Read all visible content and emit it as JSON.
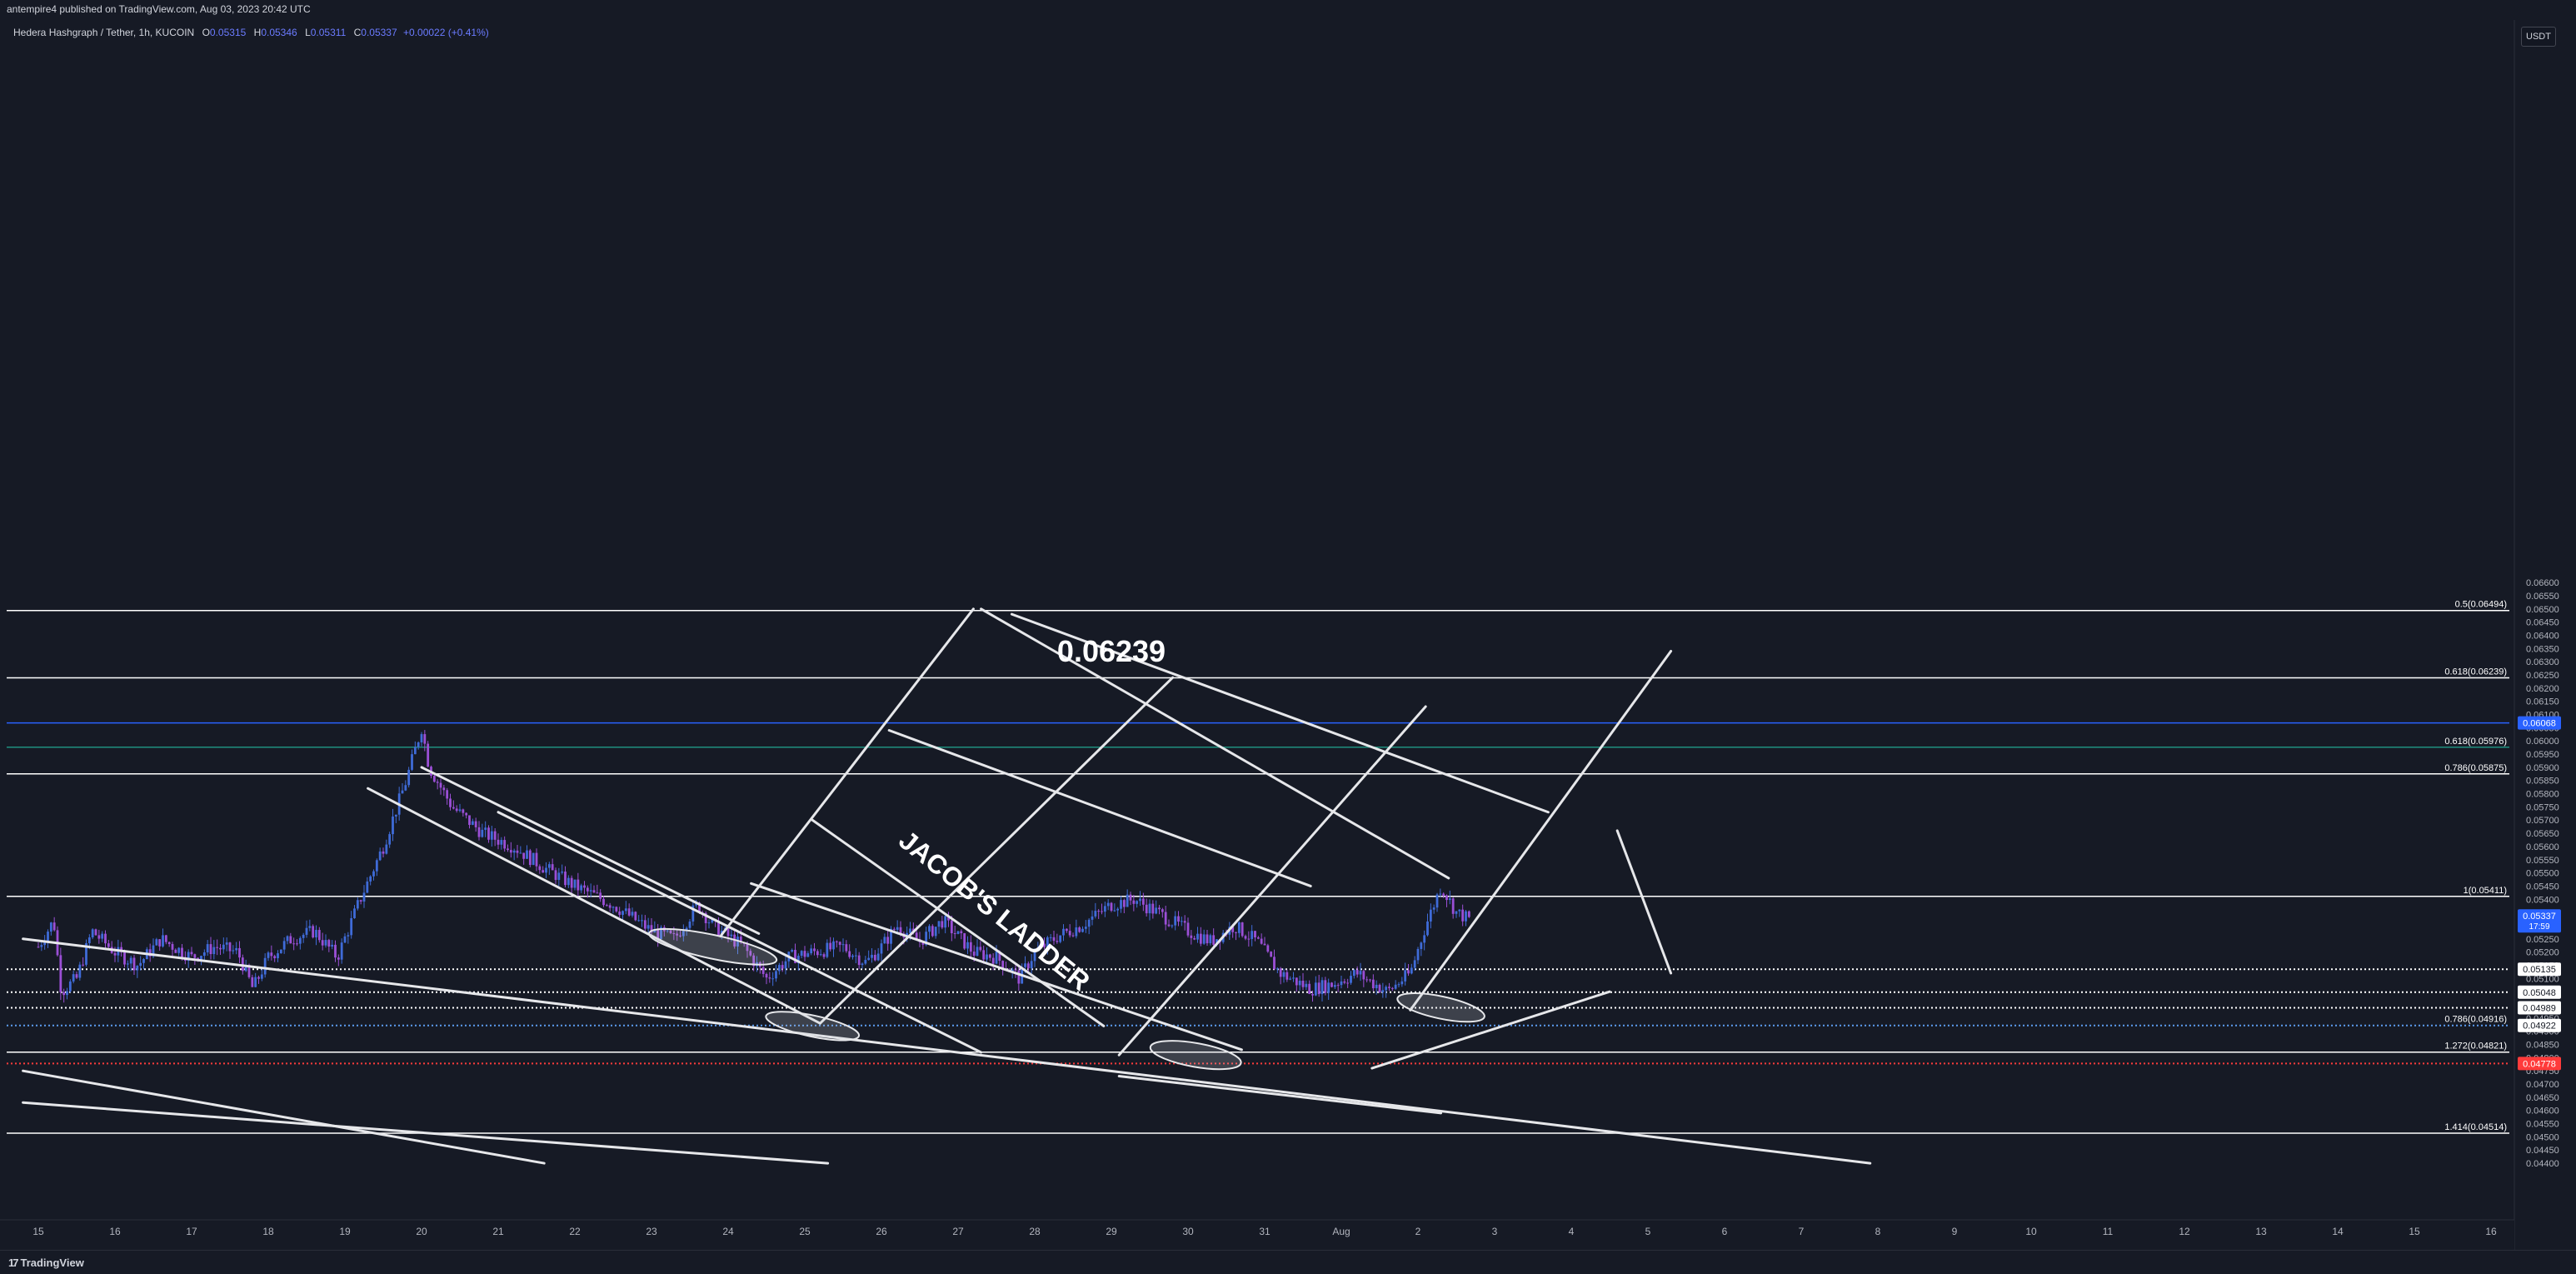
{
  "header": {
    "published": "antempire4 published on TradingView.com, Aug 03, 2023 20:42 UTC"
  },
  "legend": {
    "symbol": "Hedera Hashgraph / Tether, 1h, KUCOIN",
    "open_label": "O",
    "open": "0.05315",
    "high_label": "H",
    "high": "0.05346",
    "low_label": "L",
    "low": "0.05311",
    "close_label": "C",
    "close": "0.05337",
    "change": "+0.00022 (+0.41%)"
  },
  "currency_button": "USDT",
  "footer": {
    "logo_glyph": "17",
    "brand": "TradingView"
  },
  "colors": {
    "background": "#161a25",
    "candle_up": "#3f6bd8",
    "candle_down": "#9b4fd6",
    "hline_blue": "#2962ff",
    "hline_teal": "#1f8f7e",
    "hline_red": "#ff3b3b",
    "drawing": "#e6e7ea"
  },
  "chart_data": {
    "type": "candlestick",
    "title": "Hedera Hashgraph / Tether, 1h, KUCOIN",
    "ylim": [
      0.044,
      0.066
    ],
    "y_ticks": [
      "0.06600",
      "0.06550",
      "0.06500",
      "0.06450",
      "0.06400",
      "0.06350",
      "0.06300",
      "0.06250",
      "0.06200",
      "0.06150",
      "0.06100",
      "0.06050",
      "0.06000",
      "0.05950",
      "0.05900",
      "0.05850",
      "0.05800",
      "0.05750",
      "0.05700",
      "0.05650",
      "0.05600",
      "0.05550",
      "0.05500",
      "0.05450",
      "0.05400",
      "0.05350",
      "0.05300",
      "0.05250",
      "0.05200",
      "0.05150",
      "0.05100",
      "0.05050",
      "0.05000",
      "0.04950",
      "0.04900",
      "0.04850",
      "0.04800",
      "0.04750",
      "0.04700",
      "0.04650",
      "0.04600",
      "0.04550",
      "0.04500",
      "0.04450",
      "0.04400"
    ],
    "x_ticks": [
      "15",
      "16",
      "17",
      "18",
      "19",
      "20",
      "21",
      "22",
      "23",
      "24",
      "25",
      "26",
      "27",
      "28",
      "29",
      "30",
      "31",
      "Aug",
      "2",
      "3",
      "4",
      "5",
      "6",
      "7",
      "8",
      "9",
      "10",
      "11",
      "12",
      "13",
      "14",
      "15",
      "16"
    ],
    "series_path": [
      [
        15.0,
        0.0522
      ],
      [
        15.2,
        0.0532
      ],
      [
        15.3,
        0.0505
      ],
      [
        15.5,
        0.051
      ],
      [
        15.7,
        0.0528
      ],
      [
        16.0,
        0.052
      ],
      [
        16.3,
        0.0515
      ],
      [
        16.6,
        0.0525
      ],
      [
        17.0,
        0.0518
      ],
      [
        17.3,
        0.0522
      ],
      [
        17.6,
        0.052
      ],
      [
        17.8,
        0.0506
      ],
      [
        18.0,
        0.0518
      ],
      [
        18.3,
        0.0525
      ],
      [
        18.6,
        0.0528
      ],
      [
        18.9,
        0.0518
      ],
      [
        19.2,
        0.054
      ],
      [
        19.5,
        0.056
      ],
      [
        19.8,
        0.0585
      ],
      [
        20.0,
        0.0605
      ],
      [
        20.1,
        0.059
      ],
      [
        20.4,
        0.0575
      ],
      [
        20.8,
        0.0565
      ],
      [
        21.2,
        0.056
      ],
      [
        21.6,
        0.0552
      ],
      [
        22.0,
        0.0545
      ],
      [
        22.5,
        0.0538
      ],
      [
        23.0,
        0.0528
      ],
      [
        23.3,
        0.0525
      ],
      [
        23.6,
        0.0538
      ],
      [
        23.8,
        0.053
      ],
      [
        24.2,
        0.0522
      ],
      [
        24.5,
        0.051
      ],
      [
        24.8,
        0.0518
      ],
      [
        25.1,
        0.052
      ],
      [
        25.5,
        0.0522
      ],
      [
        25.8,
        0.0516
      ],
      [
        26.0,
        0.0522
      ],
      [
        26.2,
        0.053
      ],
      [
        26.5,
        0.0524
      ],
      [
        26.8,
        0.0532
      ],
      [
        27.0,
        0.0526
      ],
      [
        27.2,
        0.052
      ],
      [
        27.5,
        0.0518
      ],
      [
        27.8,
        0.051
      ],
      [
        28.0,
        0.052
      ],
      [
        28.3,
        0.0526
      ],
      [
        28.6,
        0.053
      ],
      [
        29.0,
        0.0538
      ],
      [
        29.3,
        0.054
      ],
      [
        29.6,
        0.0535
      ],
      [
        30.0,
        0.0528
      ],
      [
        30.3,
        0.0524
      ],
      [
        30.6,
        0.053
      ],
      [
        30.9,
        0.0524
      ],
      [
        31.2,
        0.0512
      ],
      [
        31.6,
        0.0506
      ],
      [
        31.9,
        0.0508
      ],
      [
        32.2,
        0.0512
      ],
      [
        32.6,
        0.0505
      ],
      [
        32.9,
        0.0512
      ],
      [
        33.1,
        0.053
      ],
      [
        33.3,
        0.0545
      ],
      [
        33.5,
        0.0535
      ],
      [
        33.7,
        0.0532
      ]
    ],
    "price_labels": [
      {
        "value": 0.06068,
        "text": "0.06068",
        "color": "#2962ff"
      },
      {
        "value": 0.05337,
        "text": "0.05337",
        "sub": "17:59",
        "color": "#2962ff"
      },
      {
        "value": 0.05135,
        "text": "0.05135",
        "color": "#ffffff"
      },
      {
        "value": 0.05048,
        "text": "0.05048",
        "color": "#ffffff"
      },
      {
        "value": 0.04989,
        "text": "0.04989",
        "color": "#ffffff"
      },
      {
        "value": 0.04922,
        "text": "0.04922",
        "color": "#ffffff"
      },
      {
        "value": 0.04778,
        "text": "0.04778",
        "color": "#ff3b3b"
      }
    ],
    "fib_lines": [
      {
        "value": 0.06494,
        "label": "0.5(0.06494)",
        "style": "solid",
        "color": "#ffffff"
      },
      {
        "value": 0.06239,
        "label": "0.618(0.06239)",
        "style": "solid",
        "color": "#ffffff"
      },
      {
        "value": 0.06068,
        "label": "",
        "style": "solid",
        "color": "#2962ff"
      },
      {
        "value": 0.05976,
        "label": "0.618(0.05976)",
        "style": "solid",
        "color": "#1f8f7e"
      },
      {
        "value": 0.05875,
        "label": "0.786(0.05875)",
        "style": "solid",
        "color": "#ffffff"
      },
      {
        "value": 0.05411,
        "label": "1(0.05411)",
        "style": "solid",
        "color": "#ffffff"
      },
      {
        "value": 0.05135,
        "label": "",
        "style": "dotted",
        "color": "#ffffff"
      },
      {
        "value": 0.05048,
        "label": "",
        "style": "dotted",
        "color": "#ffffff"
      },
      {
        "value": 0.04989,
        "label": "",
        "style": "dotted",
        "color": "#ffffff"
      },
      {
        "value": 0.04922,
        "label": "0.786(0.04916)",
        "style": "dotted",
        "color": "#5b9cf0"
      },
      {
        "value": 0.04821,
        "label": "1.272(0.04821)",
        "style": "solid",
        "color": "#ffffff"
      },
      {
        "value": 0.04778,
        "label": "",
        "style": "dotted",
        "color": "#ff3b3b"
      },
      {
        "value": 0.04514,
        "label": "1.414(0.04514)",
        "style": "solid",
        "color": "#ffffff"
      }
    ],
    "annotations": [
      {
        "text": "0.06239",
        "x": 29.0,
        "y": 0.063,
        "size": 36,
        "rotate": 0
      },
      {
        "text": "JACOB'S LADDER",
        "x": 27.4,
        "y": 0.0533,
        "size": 32,
        "rotate": 39
      }
    ],
    "trend_lines": [
      [
        [
          20.0,
          0.059
        ],
        [
          24.4,
          0.0527
        ]
      ],
      [
        [
          19.3,
          0.0582
        ],
        [
          25.2,
          0.0493
        ]
      ],
      [
        [
          21.0,
          0.0573
        ],
        [
          27.3,
          0.0482
        ]
      ],
      [
        [
          24.3,
          0.0546
        ],
        [
          30.7,
          0.0483
        ]
      ],
      [
        [
          25.1,
          0.057
        ],
        [
          28.9,
          0.0492
        ]
      ],
      [
        [
          26.1,
          0.0604
        ],
        [
          31.6,
          0.0545
        ]
      ],
      [
        [
          27.3,
          0.065
        ],
        [
          33.4,
          0.0548
        ]
      ],
      [
        [
          27.7,
          0.0648
        ],
        [
          34.7,
          0.0573
        ]
      ],
      [
        [
          35.6,
          0.0566
        ],
        [
          36.3,
          0.0512
        ]
      ],
      [
        [
          35.5,
          0.0505
        ],
        [
          32.4,
          0.0476
        ]
      ],
      [
        [
          23.9,
          0.0526
        ],
        [
          27.2,
          0.065
        ]
      ],
      [
        [
          25.2,
          0.0493
        ],
        [
          29.8,
          0.0624
        ]
      ],
      [
        [
          29.1,
          0.0481
        ],
        [
          33.1,
          0.0613
        ]
      ],
      [
        [
          32.9,
          0.0498
        ],
        [
          36.3,
          0.0634
        ]
      ],
      [
        [
          14.8,
          0.0525
        ],
        [
          38.9,
          0.044
        ]
      ],
      [
        [
          14.8,
          0.0475
        ],
        [
          21.6,
          0.044
        ]
      ],
      [
        [
          14.8,
          0.0463
        ],
        [
          25.3,
          0.044
        ]
      ],
      [
        [
          29.1,
          0.0473
        ],
        [
          33.3,
          0.0459
        ]
      ]
    ],
    "ellipses": [
      [
        23.8,
        0.0522,
        0.85,
        0.00045,
        12
      ],
      [
        25.1,
        0.0492,
        0.62,
        0.0004,
        12
      ],
      [
        30.1,
        0.0481,
        0.6,
        0.00045,
        10
      ],
      [
        33.3,
        0.0499,
        0.58,
        0.00042,
        12
      ]
    ]
  }
}
